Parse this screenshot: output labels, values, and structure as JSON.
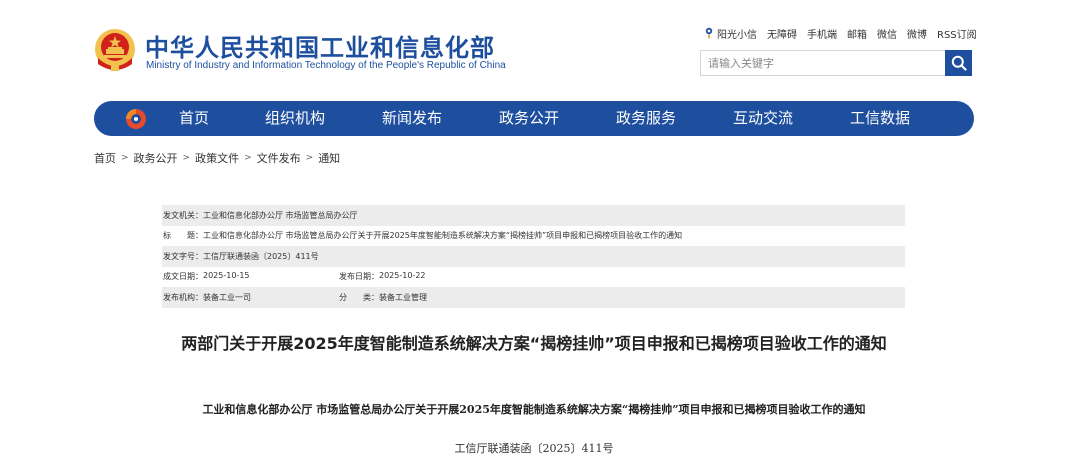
{
  "header": {
    "title_cn": "中华人民共和国工业和信息化部",
    "title_en": "Ministry of Industry and Information Technology of the People's Republic of China",
    "links": [
      "阳光小信",
      "无障碍",
      "手机端",
      "邮箱",
      "微信",
      "微博",
      "RSS订阅"
    ],
    "search": {
      "placeholder": "请输入关键字"
    }
  },
  "nav": {
    "items": [
      "首页",
      "组织机构",
      "新闻发布",
      "政务公开",
      "政务服务",
      "互动交流",
      "工信数据"
    ]
  },
  "breadcrumb": [
    "首页",
    "政务公开",
    "政策文件",
    "文件发布",
    "通知"
  ],
  "meta": {
    "issuer_label": "发文机关：",
    "issuer": "工业和信息化部办公厅 市场监管总局办公厅",
    "subject_label": "标　　题：",
    "subject": "工业和信息化部办公厅 市场监管总局办公厅关于开展2025年度智能制造系统解决方案“揭榜挂帅”项目申报和已揭榜项目验收工作的通知",
    "docno_label": "发文字号：",
    "docno": "工信厅联通装函〔2025〕411号",
    "created_label": "成文日期：",
    "created": "2025-10-15",
    "published_label": "发布日期：",
    "published": "2025-10-22",
    "org_label": "发布机构：",
    "org": "装备工业一司",
    "category_label": "分　　类：",
    "category": "装备工业管理"
  },
  "article": {
    "title": "两部门关于开展2025年度智能制造系统解决方案“揭榜挂帅”项目申报和已揭榜项目验收工作的通知",
    "subtitle": "工业和信息化部办公厅 市场监管总局办公厅关于开展2025年度智能制造系统解决方案“揭榜挂帅”项目申报和已揭榜项目验收工作的通知",
    "doc_number": "工信厅联通装函〔2025〕411号"
  },
  "colors": {
    "primary": "#1e4f9e",
    "emblem_red": "#d1211b",
    "emblem_gold": "#f2c14e",
    "meta_shade": "#ececec"
  },
  "icons": {
    "emblem": "national-emblem-icon",
    "sunshine": "sunshine-icon",
    "search": "search-icon",
    "nav_logo": "miit-logo-icon"
  }
}
